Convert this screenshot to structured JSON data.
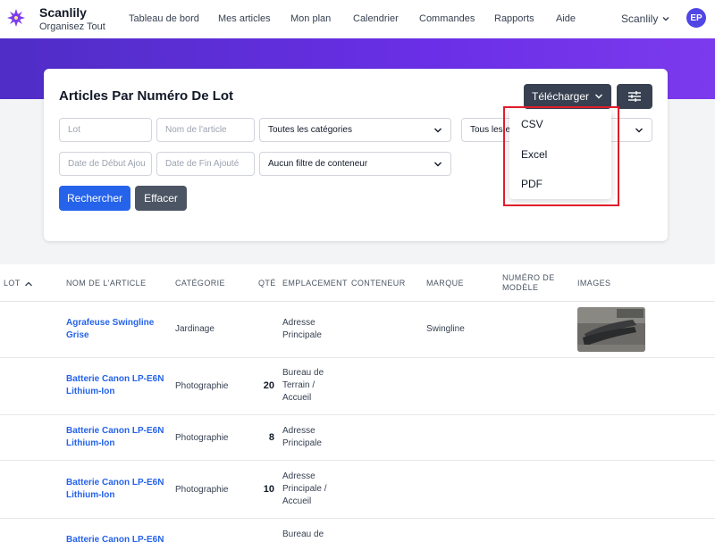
{
  "header": {
    "brand_name": "Scanlily",
    "brand_tagline": "Organisez Tout",
    "nav": [
      "Tableau de bord",
      "Mes articles",
      "Mon plan",
      "Calendrier",
      "Commandes",
      "Rapports",
      "Aide"
    ],
    "user_name": "Scanlily",
    "avatar_initials": "EP"
  },
  "card": {
    "title": "Articles Par Numéro De Lot",
    "download_label": "Télécharger",
    "fields": {
      "lot_placeholder": "Lot",
      "name_placeholder": "Nom de l'article",
      "category_value": "Toutes les catégories",
      "status_value": "Tous les e",
      "start_date_placeholder": "Date de Début Ajou",
      "end_date_placeholder": "Date de Fin Ajouté",
      "container_value": "Aucun filtre de conteneur"
    },
    "search_label": "Rechercher",
    "clear_label": "Effacer"
  },
  "dropdown": {
    "options": [
      "CSV",
      "Excel",
      "PDF"
    ]
  },
  "table": {
    "headers": {
      "lot": "LOT",
      "name": "NOM DE L'ARTICLE",
      "category": "CATÉGORIE",
      "qty": "QTÉ",
      "location": "EMPLACEMENT",
      "container": "CONTENEUR",
      "brand": "MARQUE",
      "model_line1": "NUMÉRO DE",
      "model_line2": "MODÈLE",
      "images": "IMAGES"
    },
    "rows": [
      {
        "name_line1": "Agrafeuse Swingline",
        "name_line2": "Grise",
        "category": "Jardinage",
        "qty": "",
        "location": [
          "Adresse",
          "Principale"
        ],
        "brand": "Swingline"
      },
      {
        "name_line1": "Batterie Canon LP-E6N",
        "name_line2": "Lithium-Ion",
        "category": "Photographie",
        "qty": "20",
        "location": [
          "Bureau de",
          "Terrain /",
          "Accueil"
        ],
        "brand": ""
      },
      {
        "name_line1": "Batterie Canon LP-E6N",
        "name_line2": "Lithium-Ion",
        "category": "Photographie",
        "qty": "8",
        "location": [
          "Adresse",
          "Principale"
        ],
        "brand": ""
      },
      {
        "name_line1": "Batterie Canon LP-E6N",
        "name_line2": "Lithium-Ion",
        "category": "Photographie",
        "qty": "10",
        "location": [
          "Adresse",
          "Principale /",
          "Accueil"
        ],
        "brand": ""
      },
      {
        "name_line1": "Batterie Canon LP-E6N",
        "name_line2": "",
        "category": "",
        "qty": "",
        "location": [
          "Bureau de",
          "",
          ""
        ],
        "brand": ""
      }
    ]
  }
}
